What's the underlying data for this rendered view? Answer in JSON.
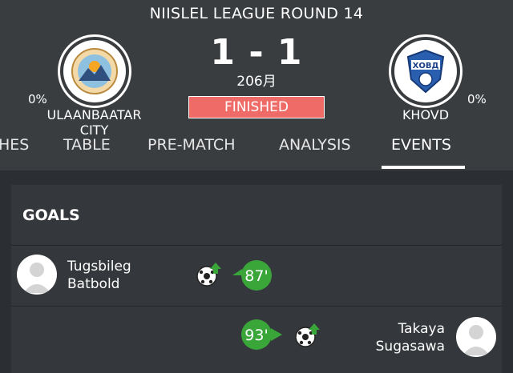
{
  "match": {
    "round_title": "NIISLEL LEAGUE ROUND 14",
    "score": "1 - 1",
    "subdate": "206月",
    "status": "FINISHED"
  },
  "home": {
    "name": "ULAANBAATAR CITY",
    "percent": "0%",
    "logo_icon": "ulaanbaatar-city-crest-icon"
  },
  "away": {
    "name": "KHOVD",
    "percent": "0%",
    "logo_icon": "khovd-crest-icon",
    "logo_text": "ХОВД"
  },
  "tabs": [
    {
      "label": "HES"
    },
    {
      "label": "TABLE"
    },
    {
      "label": "PRE-MATCH"
    },
    {
      "label": "ANALYSIS"
    },
    {
      "label": "EVENTS",
      "active": true
    }
  ],
  "events": {
    "section_title": "GOALS",
    "goals": [
      {
        "side": "home",
        "player_line1": "Tugsbileg",
        "player_line2": "Batbold",
        "minute": "87'"
      },
      {
        "side": "away",
        "player_line1": "Takaya",
        "player_line2": "Sugasawa",
        "minute": "93'"
      }
    ]
  },
  "colors": {
    "header_bg": "#3a3d40",
    "body_bg": "#2b2f33",
    "card_bg": "#34373b",
    "status_red": "#ef6b67",
    "minute_green": "#3aa63a"
  }
}
